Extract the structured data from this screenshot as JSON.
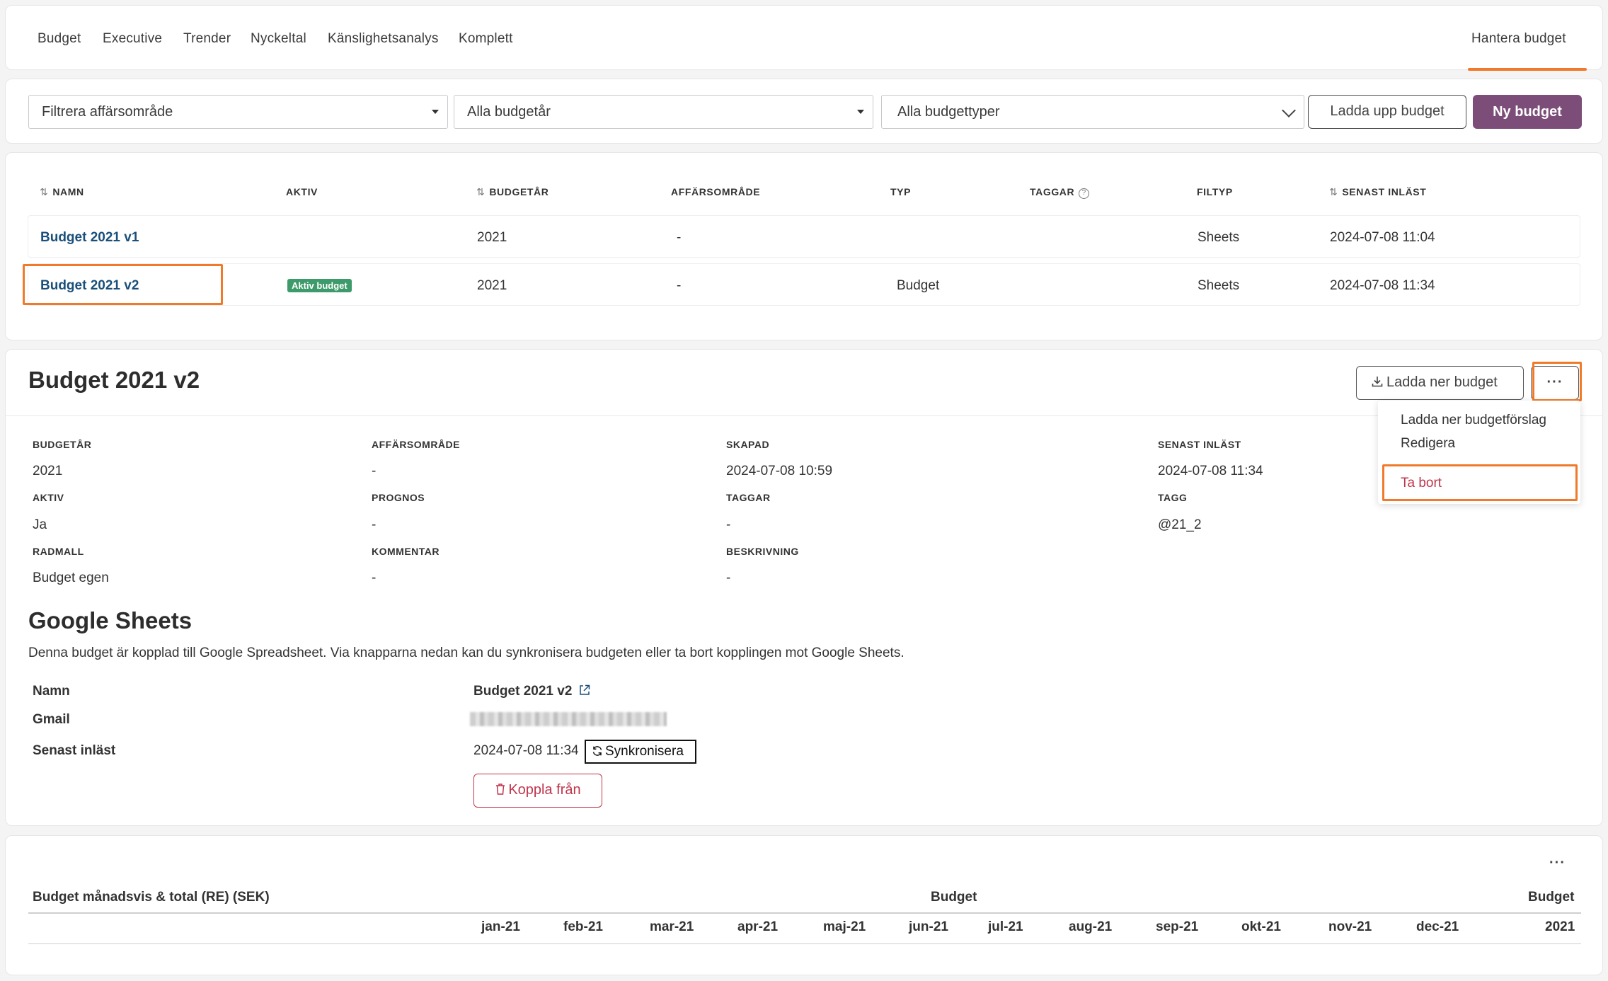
{
  "nav": {
    "items": [
      "Budget",
      "Executive",
      "Trender",
      "Nyckeltal",
      "Känslighetsanalys",
      "Komplett"
    ],
    "active": "Hantera budget"
  },
  "filters": {
    "business_area": "Filtrera affärsområde",
    "budget_year": "Alla budgetår",
    "budget_type": "Alla budgettyper",
    "upload_label": "Ladda upp budget",
    "new_label": "Ny budget"
  },
  "table": {
    "columns": [
      "NAMN",
      "AKTIV",
      "BUDGETÅR",
      "AFFÄRSOMRÅDE",
      "TYP",
      "TAGGAR",
      "FILTYP",
      "SENAST INLÄST"
    ],
    "rows": [
      {
        "name": "Budget 2021 v1",
        "active": "",
        "year": "2021",
        "area": "-",
        "type": "",
        "tags": "",
        "filetype": "Sheets",
        "loaded": "2024-07-08 11:04"
      },
      {
        "name": "Budget 2021 v2",
        "active": "Aktiv budget",
        "year": "2021",
        "area": "-",
        "type": "Budget",
        "tags": "",
        "filetype": "Sheets",
        "loaded": "2024-07-08 11:34"
      }
    ]
  },
  "details": {
    "title": "Budget 2021 v2",
    "download_label": "Ladda ner budget",
    "more_label": "···",
    "fields": {
      "budgetar_label": "BUDGETÅR",
      "budgetar": "2021",
      "affarsomrade_label": "AFFÄRSOMRÅDE",
      "affarsomrade": "-",
      "skapad_label": "SKAPAD",
      "skapad": "2024-07-08 10:59",
      "senast_label": "SENAST INLÄST",
      "senast": "2024-07-08 11:34",
      "aktiv_label": "AKTIV",
      "aktiv": "Ja",
      "prognos_label": "PROGNOS",
      "prognos": "-",
      "taggar_label": "TAGGAR",
      "taggar": "-",
      "tagg_label": "TAGG",
      "tagg": "@21_2",
      "radmall_label": "RADMALL",
      "radmall": "Budget egen",
      "kommentar_label": "KOMMENTAR",
      "kommentar": "-",
      "beskrivning_label": "BESKRIVNING",
      "beskrivning": "-"
    },
    "menu": [
      "Ladda ner budgetförslag",
      "Redigera",
      "Ta bort"
    ]
  },
  "google": {
    "title": "Google Sheets",
    "description": "Denna budget är kopplad till Google Spreadsheet. Via knapparna nedan kan du synkronisera budgeten eller ta bort kopplingen mot Google Sheets.",
    "name_label": "Namn",
    "name_value": "Budget 2021 v2",
    "gmail_label": "Gmail",
    "loaded_label": "Senast inläst",
    "loaded_value": "2024-07-08 11:34",
    "sync_label": "Synkronisera",
    "unlink_label": "Koppla från"
  },
  "monthly": {
    "title": "Budget månadsvis & total (RE) (SEK)",
    "group_budget": "Budget",
    "group_total": "Budget",
    "months": [
      "jan-21",
      "feb-21",
      "mar-21",
      "apr-21",
      "maj-21",
      "jun-21",
      "jul-21",
      "aug-21",
      "sep-21",
      "okt-21",
      "nov-21",
      "dec-21"
    ],
    "total_col": "2021",
    "more_label": "···"
  },
  "colors": {
    "accent": "#f07a2a",
    "primary": "#7b4d78",
    "link": "#1a4f7a",
    "badge": "#3d9a6a",
    "danger": "#c0344b"
  }
}
